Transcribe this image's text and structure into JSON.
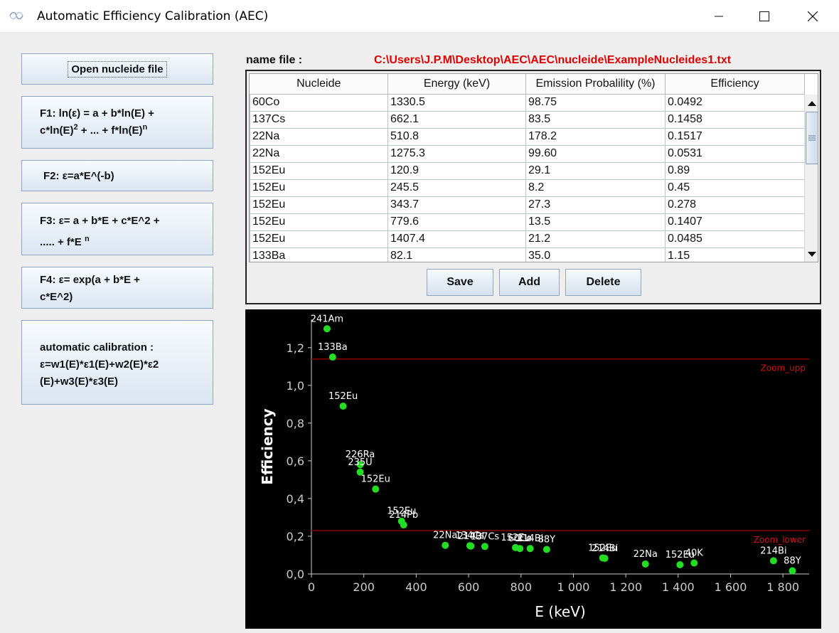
{
  "window": {
    "title": "Automatic Efficiency Calibration (AEC)",
    "min_icon": "minimize-icon",
    "max_icon": "maximize-icon",
    "close_icon": "close-icon"
  },
  "left_panel": {
    "open_button": "Open nucleide file",
    "f1": {
      "line1": "F1: ln(ε) = a + b*ln(E) +",
      "l2a": "c*ln(E)",
      "l2b": "2",
      "l2c": " + ... + f*ln(E)",
      "l2d": "n"
    },
    "f2": "F2:  ε=a*E^(-b)",
    "f3": {
      "line1": "F3: ε= a + b*E + c*E^2 +",
      "l2a": "..... + f*E ",
      "l2b": "n"
    },
    "f4": {
      "line1": "F4: ε= exp(a + b*E +",
      "line2": "c*E^2)"
    },
    "auto": {
      "line1": "automatic calibration :",
      "line2": "ε=w1(E)*ε1(E)+w2(E)*ε2",
      "line3": "(E)+w3(E)*ε3(E)"
    }
  },
  "file": {
    "label": "name file   :",
    "path": "C:\\Users\\J.P.M\\Desktop\\AEC\\AEC\\nucleide\\ExampleNucleides1.txt"
  },
  "table": {
    "headers": [
      "Nucleide",
      "Energy (keV)",
      "Emission Probalility (%)",
      "Efficiency"
    ],
    "rows": [
      [
        "60Co",
        "1330.5",
        "98.75",
        "0.0492"
      ],
      [
        "137Cs",
        "662.1",
        "83.5",
        "0.1458"
      ],
      [
        "22Na",
        "510.8",
        "178.2",
        "0.1517"
      ],
      [
        "22Na",
        "1275.3",
        "99.60",
        "0.0531"
      ],
      [
        "152Eu",
        "120.9",
        "29.1",
        "0.89"
      ],
      [
        "152Eu",
        "245.5",
        "8.2",
        "0.45"
      ],
      [
        "152Eu",
        "343.7",
        "27.3",
        "0.278"
      ],
      [
        "152Eu",
        "779.6",
        "13.5",
        "0.1407"
      ],
      [
        "152Eu",
        "1407.4",
        "21.2",
        "0.0485"
      ],
      [
        "133Ba",
        "82.1",
        "35.0",
        "1.15"
      ]
    ]
  },
  "buttons": {
    "save": "Save",
    "add": "Add",
    "delete": "Delete"
  },
  "chart_data": {
    "type": "scatter",
    "xlabel": "E (keV)",
    "ylabel": "Efficiency",
    "xlim": [
      0,
      1900
    ],
    "ylim": [
      0,
      1.35
    ],
    "x_ticks": [
      "0",
      "200",
      "400",
      "600",
      "800",
      "1 000",
      "1 200",
      "1 400",
      "1 600",
      "1 800"
    ],
    "y_ticks": [
      "0,0",
      "0,2",
      "0,4",
      "0,6",
      "0,8",
      "1,0",
      "1,2"
    ],
    "point_color": "#22dd22",
    "background": "#000000",
    "zoom_lines": [
      {
        "name": "Zoom_upp",
        "y": 1.14,
        "color": "#8b0000"
      },
      {
        "name": "Zoom_lower",
        "y": 0.23,
        "color": "#8b0000"
      }
    ],
    "points": [
      {
        "label": "241Am",
        "x": 59.5,
        "y": 1.3
      },
      {
        "label": "133Ba",
        "x": 81,
        "y": 1.15
      },
      {
        "label": "152Eu",
        "x": 121,
        "y": 0.89
      },
      {
        "label": "226Ra",
        "x": 186,
        "y": 0.58
      },
      {
        "label": "235U",
        "x": 186,
        "y": 0.54
      },
      {
        "label": "152Eu",
        "x": 245,
        "y": 0.45
      },
      {
        "label": "152Eu",
        "x": 344,
        "y": 0.28
      },
      {
        "label": "214Pb",
        "x": 352,
        "y": 0.26
      },
      {
        "label": "22Na",
        "x": 511,
        "y": 0.152
      },
      {
        "label": "134Cs",
        "x": 605,
        "y": 0.15
      },
      {
        "label": "214Bi",
        "x": 609,
        "y": 0.148
      },
      {
        "label": "137Cs",
        "x": 662,
        "y": 0.146
      },
      {
        "label": "152Eu",
        "x": 779,
        "y": 0.14
      },
      {
        "label": "60Co",
        "x": 796,
        "y": 0.135
      },
      {
        "label": "214Bi",
        "x": 835,
        "y": 0.135
      },
      {
        "label": "88Y",
        "x": 898,
        "y": 0.13
      },
      {
        "label": "152Eu",
        "x": 1112,
        "y": 0.085
      },
      {
        "label": "214Bi",
        "x": 1120,
        "y": 0.083
      },
      {
        "label": "22Na",
        "x": 1275,
        "y": 0.053
      },
      {
        "label": "152Eu",
        "x": 1407,
        "y": 0.049
      },
      {
        "label": "40K",
        "x": 1461,
        "y": 0.058
      },
      {
        "label": "214Bi",
        "x": 1764,
        "y": 0.07
      },
      {
        "label": "88Y",
        "x": 1836,
        "y": 0.017
      }
    ]
  }
}
